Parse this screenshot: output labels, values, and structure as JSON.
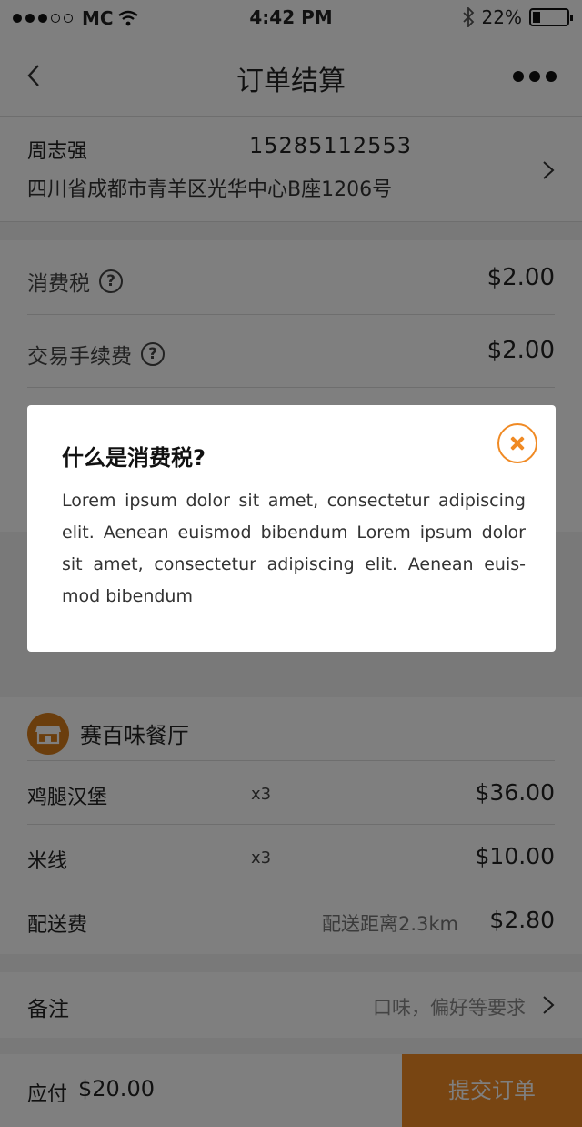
{
  "status_bar": {
    "carrier": "MC",
    "time": "4:42 PM",
    "battery": "22%",
    "battery_level": 0.22
  },
  "nav": {
    "title": "订单结算",
    "back_icon": "chevron-left-icon",
    "more_icon": "more-dots-icon"
  },
  "address": {
    "name": "周志强",
    "phone": "15285112553",
    "line": "四川省成都市青羊区光华中心B座1206号"
  },
  "fees": [
    {
      "label": "消费税",
      "value": "$2.00"
    },
    {
      "label": "交易手续费",
      "value": "$2.00"
    }
  ],
  "modal": {
    "title": "什么是消费税?",
    "body": "Lorem ipsum dolor sit amet, consectetur adipiscing elit. Aenean euismod bibendum Lorem ipsum dolor sit amet, consectetur adipiscing elit. Aenean euis-mod bibendum"
  },
  "shop": {
    "name": "赛百味餐厅",
    "items": [
      {
        "name": "鸡腿汉堡",
        "qty": "x3",
        "price": "$36.00"
      },
      {
        "name": "米线",
        "qty": "x3",
        "price": "$10.00"
      }
    ],
    "delivery": {
      "name": "配送费",
      "note": "配送距离2.3km",
      "price": "$2.80"
    }
  },
  "remark": {
    "label": "备注",
    "hint": "口味，偏好等要求"
  },
  "bottom": {
    "pay_label": "应付",
    "pay_amount": "$20.00",
    "submit": "提交订单"
  },
  "colors": {
    "accent": "#f08a24",
    "shop_icon_bg": "#d77c1b"
  }
}
